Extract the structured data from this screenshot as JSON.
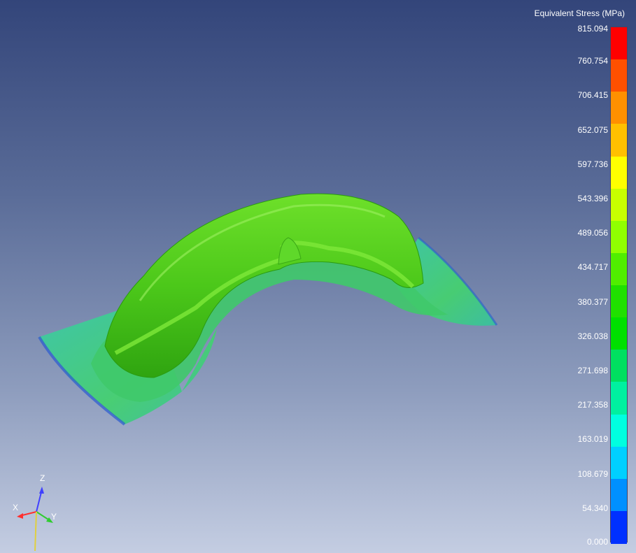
{
  "legend": {
    "title": "Equivalent Stress (MPa)",
    "tick_labels": [
      "815.094",
      "760.754",
      "706.415",
      "652.075",
      "597.736",
      "543.396",
      "489.056",
      "434.717",
      "380.377",
      "326.038",
      "271.698",
      "217.358",
      "163.019",
      "108.679",
      "54.340",
      "0.000"
    ],
    "band_colors_top_to_bottom": [
      "#ff0000",
      "#ff5000",
      "#ff9000",
      "#ffc000",
      "#ffff00",
      "#c8ff00",
      "#90ff00",
      "#50ee00",
      "#20e000",
      "#00e000",
      "#00e060",
      "#00f0a0",
      "#00ffe0",
      "#00d0ff",
      "#0090ff",
      "#0030ff"
    ]
  },
  "triad": {
    "z_label": "Z",
    "x_label": "X",
    "y_label": "Y"
  },
  "model": {
    "description_colors": {
      "body": "#4ccf18",
      "flange": "#3ad38a",
      "edge": "#2a5ad0"
    }
  }
}
